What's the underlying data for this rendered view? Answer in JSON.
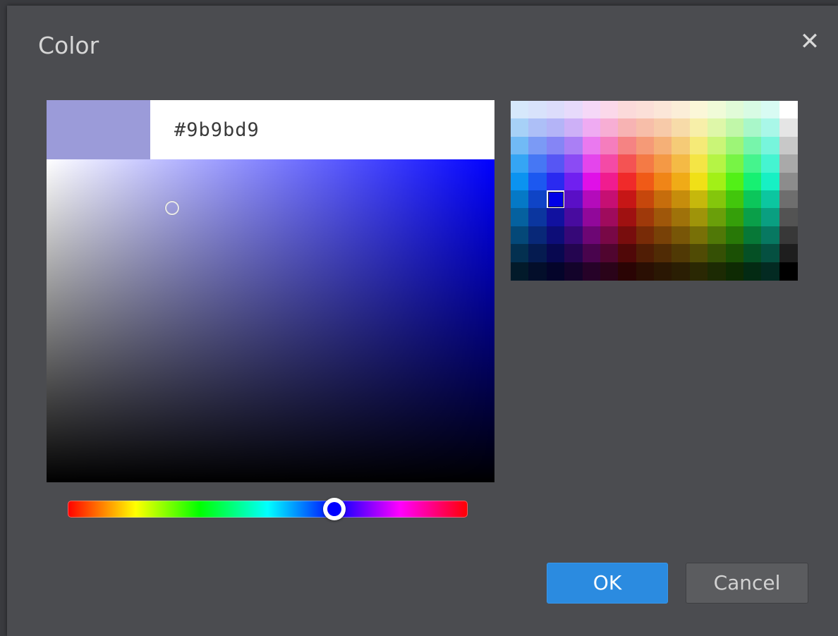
{
  "dialog": {
    "title": "Color",
    "close_glyph": "✕"
  },
  "current": {
    "hex": "#9b9bd9",
    "hue_color": "#0000ff",
    "hue_degrees": 240,
    "saturation": 0.28,
    "brightness": 0.85
  },
  "palette": {
    "columns": 16,
    "rows": 10,
    "selected": {
      "row": 5,
      "col": 2
    },
    "colors": [
      [
        "#d6e8fb",
        "#d8e2fb",
        "#dcdcfb",
        "#e7dafb",
        "#f5d8f7",
        "#fbd8ea",
        "#fbdada",
        "#fbdfd8",
        "#fbe6d8",
        "#fbeed8",
        "#fbf7d8",
        "#f0fbd8",
        "#e1fbd8",
        "#d8fbe4",
        "#d8fbf3",
        "#ffffff"
      ],
      [
        "#a7d1f7",
        "#adbff7",
        "#b4b4f7",
        "#cdb0f7",
        "#efabf2",
        "#f7aed4",
        "#f7b3b3",
        "#f7bea9",
        "#f7caa9",
        "#f7dba9",
        "#f7efa9",
        "#def7a9",
        "#c1f7a9",
        "#a9f7c9",
        "#a9f7e8",
        "#e5e5e5"
      ],
      [
        "#71baf5",
        "#7b9af5",
        "#8585f5",
        "#aa7ff5",
        "#ea79ef",
        "#f57dbd",
        "#f58383",
        "#f59a77",
        "#f5b077",
        "#f5cb77",
        "#f5ea77",
        "#caf577",
        "#9df577",
        "#77f5ab",
        "#77f5dc",
        "#c8c8c8"
      ],
      [
        "#35a5f4",
        "#4677f4",
        "#5656f4",
        "#8b4bf4",
        "#e445ec",
        "#f44aa6",
        "#f45353",
        "#f47a45",
        "#f49945",
        "#f4ba45",
        "#f4e545",
        "#b5f445",
        "#77f445",
        "#45f48d",
        "#45f4d1",
        "#a9a9a9"
      ],
      [
        "#0b93f0",
        "#1c58f0",
        "#2a2af0",
        "#7020f0",
        "#e010e7",
        "#f01c8f",
        "#f02a2a",
        "#f05a17",
        "#f08517",
        "#f0ab17",
        "#f0e017",
        "#a2f017",
        "#52f017",
        "#17f072",
        "#17f0c4",
        "#8c8c8c"
      ],
      [
        "#0579c6",
        "#0f44c6",
        "#0000e6",
        "#5a0fc6",
        "#b40bbb",
        "#c60f73",
        "#c61616",
        "#c6470c",
        "#c66d0c",
        "#c68d0c",
        "#c6b80c",
        "#84c60c",
        "#42c60c",
        "#0cc65b",
        "#0cc6a0",
        "#6e6e6e"
      ],
      [
        "#05619f",
        "#0b369f",
        "#11119f",
        "#480b9f",
        "#91089a",
        "#9f0b5d",
        "#9f1111",
        "#9f390a",
        "#9f570a",
        "#9f720a",
        "#9f940a",
        "#6a9f0a",
        "#359f0a",
        "#0a9f49",
        "#0a9f81",
        "#535353"
      ],
      [
        "#044878",
        "#082878",
        "#0d0d78",
        "#360878",
        "#6d0674",
        "#780846",
        "#780d0d",
        "#782b07",
        "#784107",
        "#785607",
        "#787007",
        "#507807",
        "#287807",
        "#077837",
        "#077861",
        "#383838"
      ],
      [
        "#033050",
        "#051b50",
        "#080850",
        "#240550",
        "#49044d",
        "#50052f",
        "#500808",
        "#501d05",
        "#502b05",
        "#503905",
        "#504b05",
        "#355005",
        "#1b5005",
        "#055025",
        "#055041",
        "#1e1e1e"
      ],
      [
        "#021a2a",
        "#030e2a",
        "#04042a",
        "#13032a",
        "#260228",
        "#2a0319",
        "#2a0404",
        "#2a0f03",
        "#2a1703",
        "#2a1e03",
        "#2a2803",
        "#1c2a03",
        "#0e2a03",
        "#032a13",
        "#032a22",
        "#000000"
      ]
    ]
  },
  "buttons": {
    "ok": "OK",
    "cancel": "Cancel"
  }
}
